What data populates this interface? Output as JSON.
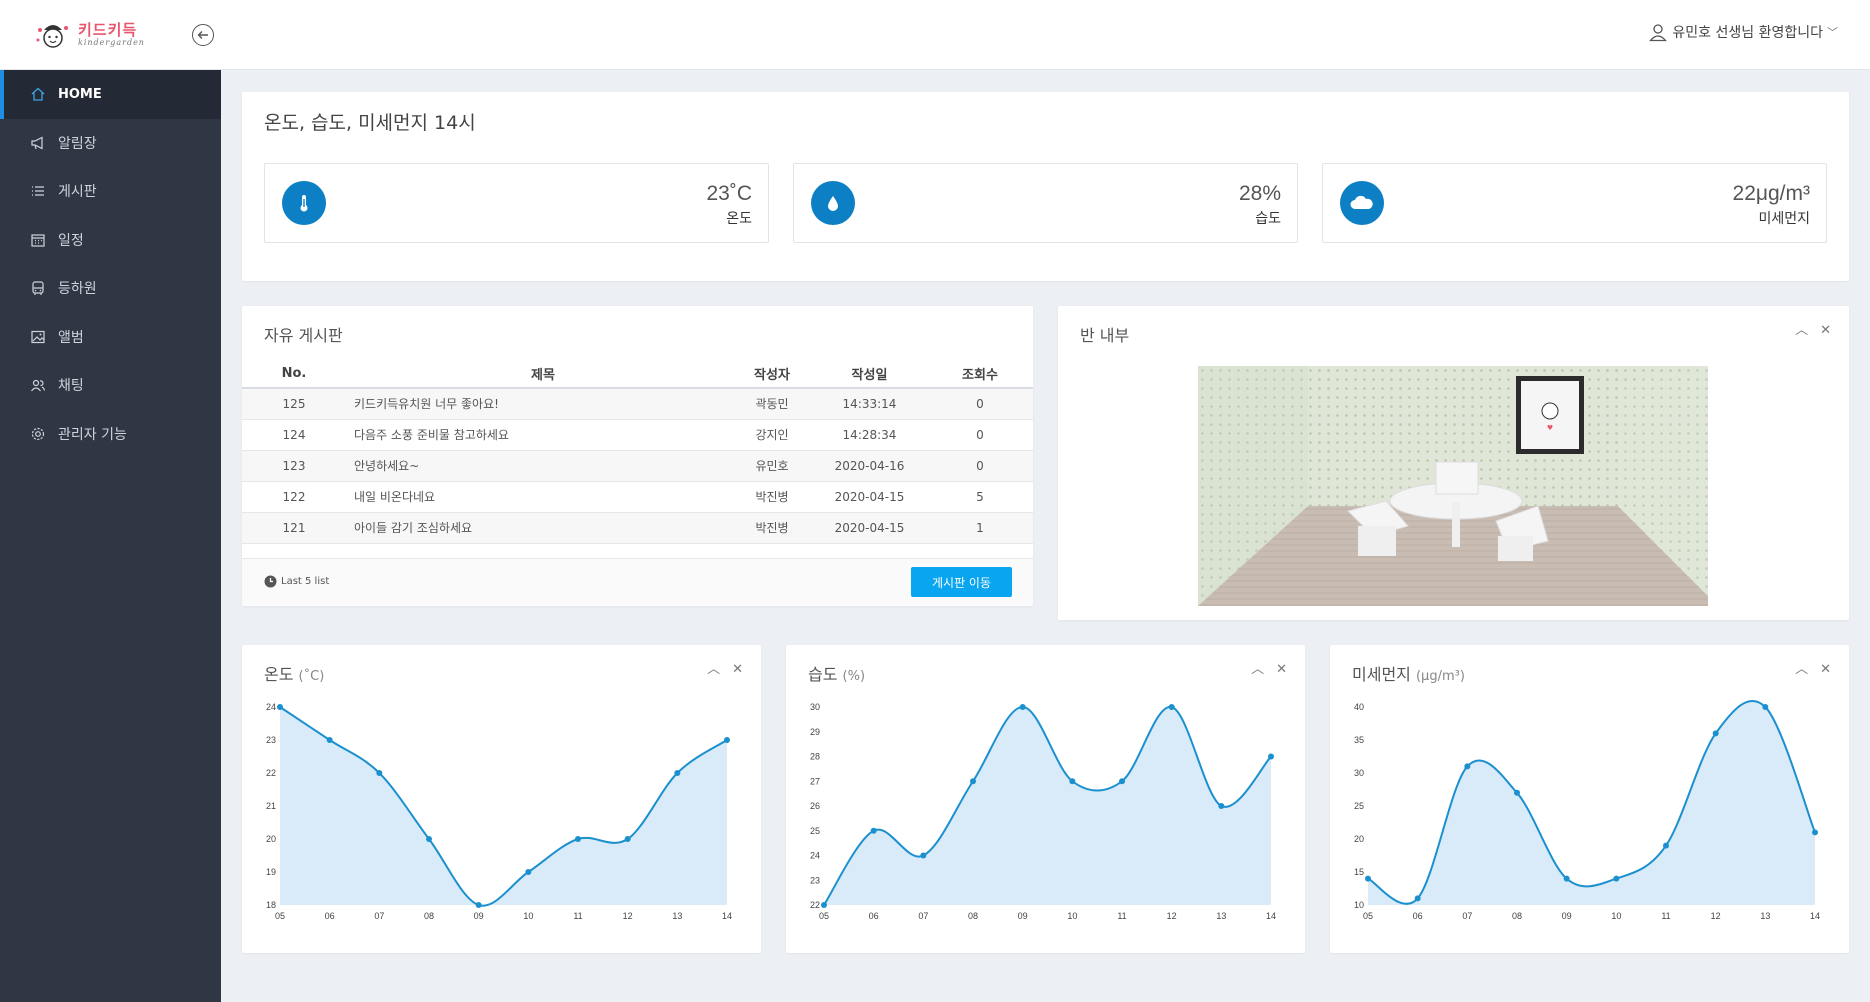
{
  "header": {
    "logo_text": "키드키득",
    "logo_sub": "kindergarden",
    "user_greeting": "유민호 선생님 환영합니다",
    "caret": "﹀"
  },
  "sidebar": {
    "items": [
      {
        "label": "HOME",
        "icon": "home-icon"
      },
      {
        "label": "알림장",
        "icon": "megaphone-icon"
      },
      {
        "label": "게시판",
        "icon": "list-icon"
      },
      {
        "label": "일정",
        "icon": "calendar-icon"
      },
      {
        "label": "등하원",
        "icon": "bus-icon"
      },
      {
        "label": "앨범",
        "icon": "image-icon"
      },
      {
        "label": "채팅",
        "icon": "users-icon"
      },
      {
        "label": "관리자 기능",
        "icon": "gear-icon"
      }
    ]
  },
  "environment": {
    "title": "온도, 습도, 미세먼지 14시",
    "cards": [
      {
        "value": "23˚C",
        "label": "온도",
        "icon": "thermometer-icon"
      },
      {
        "value": "28%",
        "label": "습도",
        "icon": "droplet-icon"
      },
      {
        "value": "22μg/m³",
        "label": "미세먼지",
        "icon": "cloud-icon"
      }
    ]
  },
  "board": {
    "title": "자유 게시판",
    "columns": [
      "No.",
      "제목",
      "작성자",
      "작성일",
      "조회수"
    ],
    "rows": [
      {
        "no": "125",
        "title": "키드키득유치원 너무 좋아요!",
        "author": "곽동민",
        "date": "14:33:14",
        "views": "0"
      },
      {
        "no": "124",
        "title": "다음주 소풍 준비물 참고하세요",
        "author": "강지인",
        "date": "14:28:34",
        "views": "0"
      },
      {
        "no": "123",
        "title": "안녕하세요~",
        "author": "유민호",
        "date": "2020-04-16",
        "views": "0"
      },
      {
        "no": "122",
        "title": "내일 비온다네요",
        "author": "박진병",
        "date": "2020-04-15",
        "views": "5"
      },
      {
        "no": "121",
        "title": "아이들 감기 조심하세요",
        "author": "박진병",
        "date": "2020-04-15",
        "views": "1"
      }
    ],
    "footer_note": "Last 5 list",
    "button_label": "게시판 이동"
  },
  "classroom": {
    "title": "반 내부"
  },
  "panel_tools": {
    "collapse": "︿",
    "close": "✕"
  },
  "colors": {
    "accent": "#0d7fc4",
    "button": "#0aa5f0",
    "chart_line": "#1a90cf",
    "chart_fill": "#d9ebf8",
    "sidebar": "#2f3744"
  },
  "chart_data": [
    {
      "type": "area",
      "title": "온도",
      "unit": "(˚C)",
      "x": [
        "05",
        "06",
        "07",
        "08",
        "09",
        "10",
        "11",
        "12",
        "13",
        "14"
      ],
      "series": [
        {
          "values": [
            24,
            23,
            22,
            20,
            18,
            19,
            20,
            20,
            22,
            23
          ]
        }
      ],
      "ylim": [
        18,
        24
      ],
      "yticks": [
        18,
        19,
        20,
        21,
        22,
        23,
        24
      ]
    },
    {
      "type": "area",
      "title": "습도",
      "unit": "(%)",
      "x": [
        "05",
        "06",
        "07",
        "08",
        "09",
        "10",
        "11",
        "12",
        "13",
        "14"
      ],
      "series": [
        {
          "values": [
            22,
            25,
            24,
            27,
            30,
            27,
            27,
            30,
            26,
            28
          ]
        }
      ],
      "ylim": [
        22,
        30
      ],
      "yticks": [
        22,
        23,
        24,
        25,
        26,
        27,
        28,
        29,
        30
      ]
    },
    {
      "type": "area",
      "title": "미세먼지",
      "unit": "(μg/m³)",
      "x": [
        "05",
        "06",
        "07",
        "08",
        "09",
        "10",
        "11",
        "12",
        "13",
        "14"
      ],
      "series": [
        {
          "values": [
            14,
            11,
            31,
            27,
            14,
            14,
            19,
            36,
            40,
            21
          ]
        }
      ],
      "ylim": [
        10,
        40
      ],
      "yticks": [
        10,
        15,
        20,
        25,
        30,
        35,
        40
      ]
    }
  ]
}
